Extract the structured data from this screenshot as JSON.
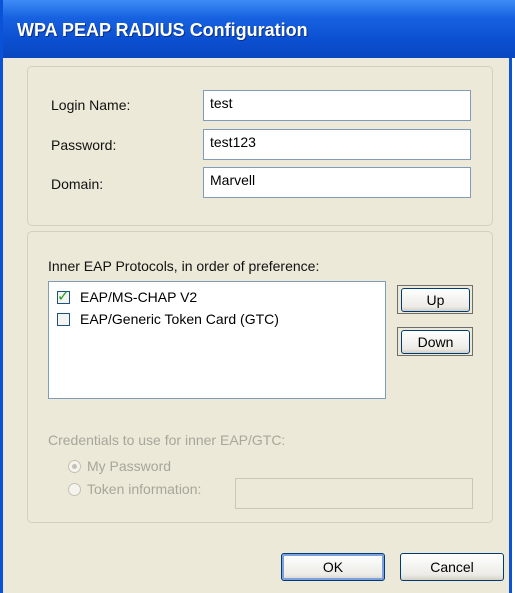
{
  "window": {
    "title": "WPA PEAP RADIUS Configuration"
  },
  "credentials": {
    "login_name": {
      "label": "Login Name:",
      "value": "test"
    },
    "password": {
      "label": "Password:",
      "value": "test123"
    },
    "domain": {
      "label": "Domain:",
      "value": "Marvell"
    }
  },
  "inner_eap": {
    "heading": "Inner EAP Protocols, in order of preference:",
    "items": [
      {
        "label": "EAP/MS-CHAP V2",
        "checked": true
      },
      {
        "label": "EAP/Generic Token Card (GTC)",
        "checked": false
      }
    ],
    "up_label": "Up",
    "down_label": "Down"
  },
  "inner_credentials": {
    "heading": "Credentials to use for inner EAP/GTC:",
    "option_my_password": "My Password",
    "option_token": "Token information:",
    "selected": "My Password",
    "token_value": ""
  },
  "buttons": {
    "ok": "OK",
    "cancel": "Cancel"
  },
  "colors": {
    "titlebar": "#0A53D6",
    "face": "#ECE9D8",
    "check": "#21A121"
  },
  "icons": {
    "checked": "check-mark",
    "radio": "radio-dot"
  }
}
